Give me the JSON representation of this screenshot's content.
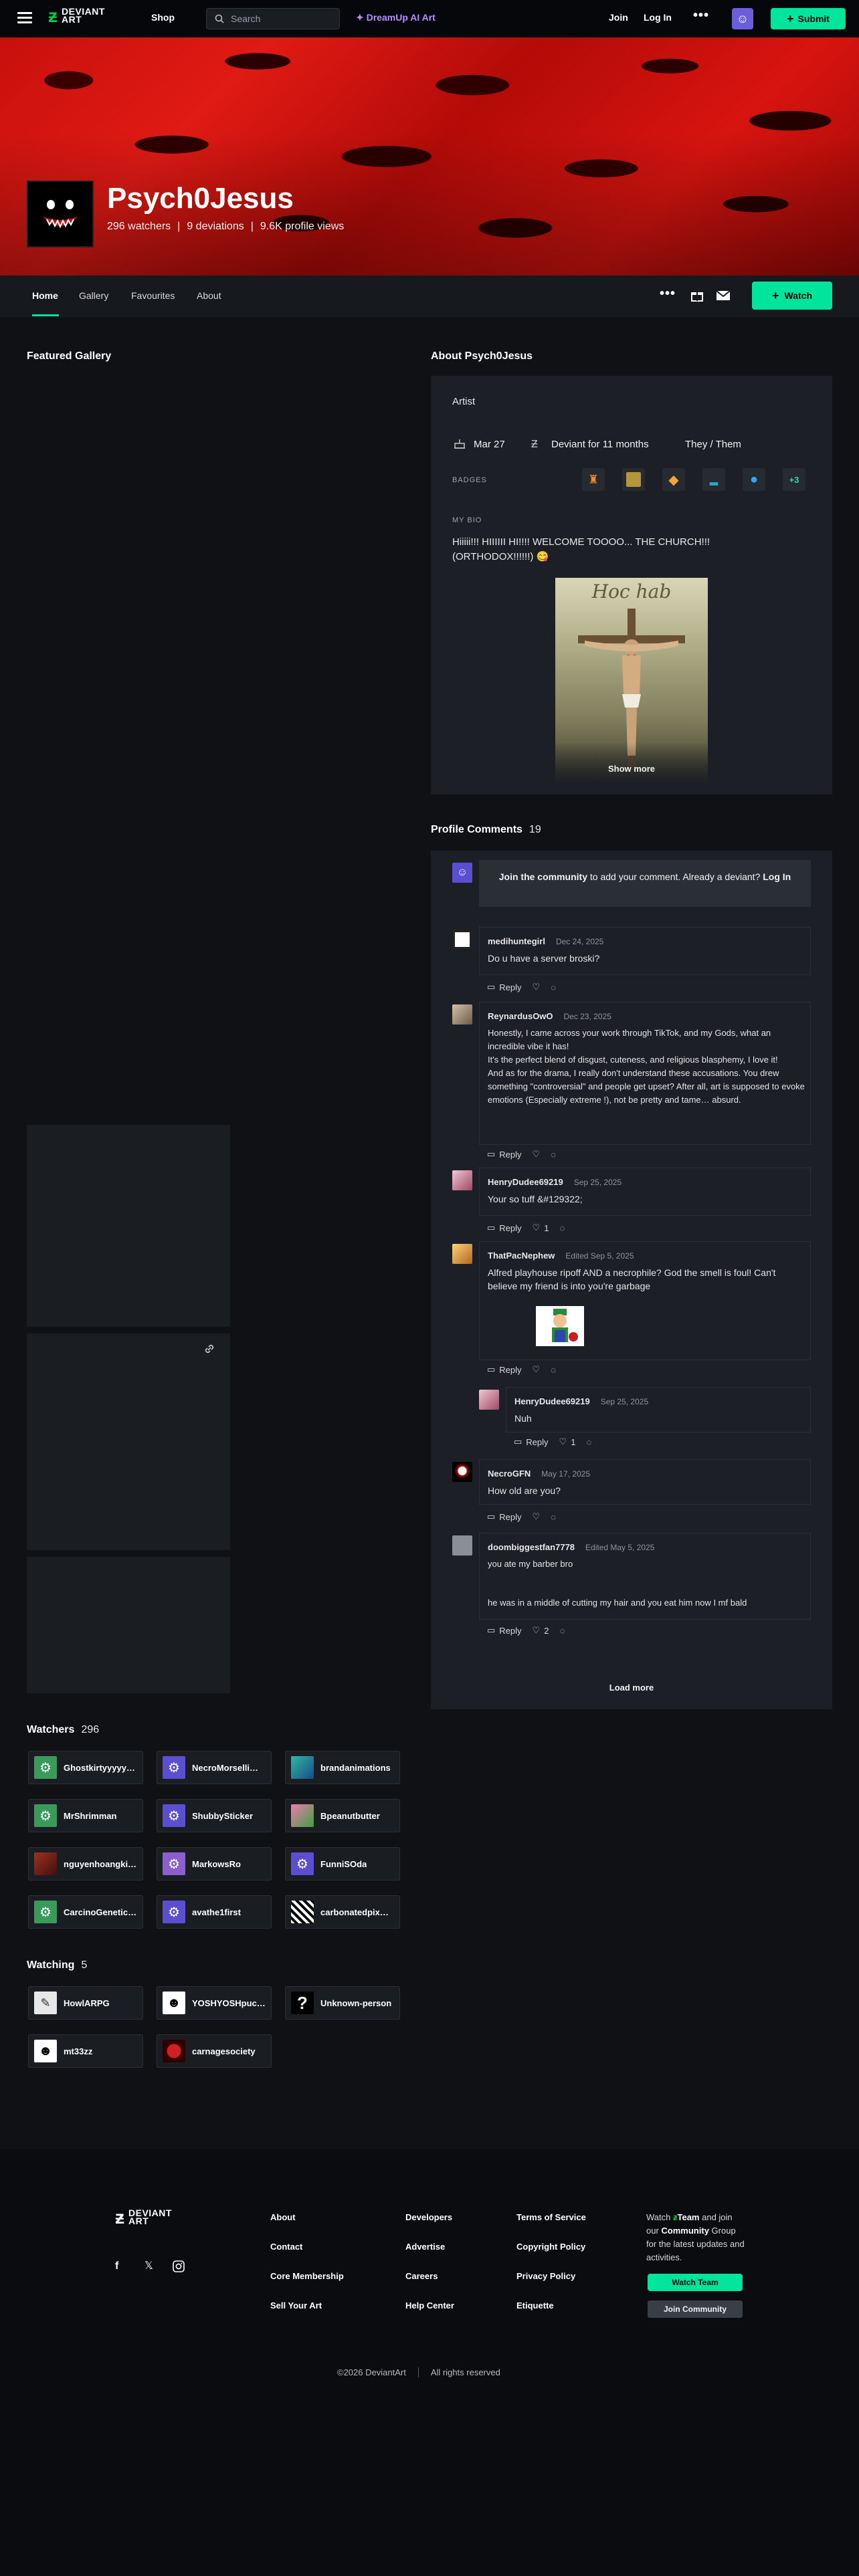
{
  "topbar": {
    "logo_text_line1": "DEVIANT",
    "logo_text_line2": "ART",
    "shop": "Shop",
    "search_placeholder": "Search",
    "dreamup": "DreamUp AI Art",
    "join": "Join",
    "login": "Log In",
    "submit": "Submit"
  },
  "profile": {
    "username": "Psych0Jesus",
    "watchers": "296 watchers",
    "deviations": "9 deviations",
    "views": "9.6K profile views",
    "separator": "|",
    "watch_button": "Watch"
  },
  "tabs": [
    "Home",
    "Gallery",
    "Favourites",
    "About"
  ],
  "featured": {
    "title": "Featured Gallery"
  },
  "about": {
    "title": "About Psych0Jesus",
    "role": "Artist",
    "birthday": "Mar 27",
    "deviant_for": "Deviant for 11 months",
    "pronouns": "They / Them",
    "badges_label": "BADGES",
    "badges_more": "+3",
    "bio_label": "MY BIO",
    "bio_text": "Hiiiii!!! HIIIIII HI!!!! WELCOME TOOOO... THE CHURCH!!! (ORTHODOX!!!!!!) 😋",
    "image_caption": "Hoc hab",
    "show_more": "Show more"
  },
  "comments": {
    "title": "Profile Comments",
    "count": "19",
    "join_prompt_bold": "Join the community",
    "join_prompt_rest": " to add your comment. Already a deviant? ",
    "join_prompt_login": "Log In",
    "reply_label": "Reply",
    "load_more": "Load more",
    "items": [
      {
        "name": "medihuntegirl",
        "date": "Dec 24, 2025",
        "text": "Do u have a server broski?",
        "likes": ""
      },
      {
        "name": "ReynardusOwO",
        "date": "Dec 23, 2025",
        "text": "Honestly, I came across your work through TikTok, and my Gods, what an incredible vibe it has!\nIt's the perfect blend of disgust, cuteness, and religious blasphemy, I love it!\nAnd as for the drama, I really don't understand these accusations. You drew something \"controversial\" and people get upset? After all, art is supposed to evoke emotions (Especially extreme !), not be pretty and tame… absurd.",
        "likes": ""
      },
      {
        "name": "HenryDudee69219",
        "date": "Sep 25, 2025",
        "text": "Your so tuff &#129322;",
        "likes": "1"
      },
      {
        "name": "ThatPacNephew",
        "date": "Edited Sep 5, 2025",
        "text": "Alfred playhouse ripoff AND a necrophile? God the smell is foul! Can't believe my friend is into you're garbage",
        "likes": ""
      },
      {
        "name": "HenryDudee69219",
        "date": "Sep 25, 2025",
        "text": "Nuh",
        "likes": "1"
      },
      {
        "name": "NecroGFN",
        "date": "May 17, 2025",
        "text": "How old are you?",
        "likes": ""
      },
      {
        "name": "doombiggestfan7778",
        "date": "Edited May 5, 2025",
        "text": "you ate my barber bro",
        "text2": "he was in a middle of cutting my hair and you eat him now I mf bald",
        "likes": "2"
      }
    ]
  },
  "watchers": {
    "title": "Watchers",
    "count": "296",
    "list": [
      "Ghostkirtyyyyy…",
      "NecroMorselli…",
      "brandanimations",
      "MrShrimman",
      "ShubbySticker",
      "Bpeanutbutter",
      "nguyenhoangki…",
      "MarkowsRo",
      "FunniSOda",
      "CarcinoGenetic…",
      "avathe1first",
      "carbonatedpix…"
    ]
  },
  "watching": {
    "title": "Watching",
    "count": "5",
    "list": [
      "HowlARPG",
      "YOSHYOSHpuc…",
      "Unknown-person",
      "mt33zz",
      "carnagesociety"
    ]
  },
  "footer": {
    "col1": [
      "About",
      "Contact",
      "Core Membership",
      "Sell Your Art"
    ],
    "col2": [
      "Developers",
      "Advertise",
      "Careers",
      "Help Center"
    ],
    "col3": [
      "Terms of Service",
      "Copyright Policy",
      "Privacy Policy",
      "Etiquette"
    ],
    "team_text1": "Watch",
    "team_text_team": "Team",
    "team_text2": "and join our",
    "team_text_community": "Community",
    "team_text3": "Group for the latest updates and activities.",
    "watch_team": "Watch Team",
    "join_community": "Join Community",
    "copyright": "©2026 DeviantArt",
    "rights": "All rights reserved"
  },
  "colors": {
    "accent": "#00e59b",
    "banner": "#c8100c",
    "background": "#0f1115",
    "dreamup": "#b88cff"
  }
}
